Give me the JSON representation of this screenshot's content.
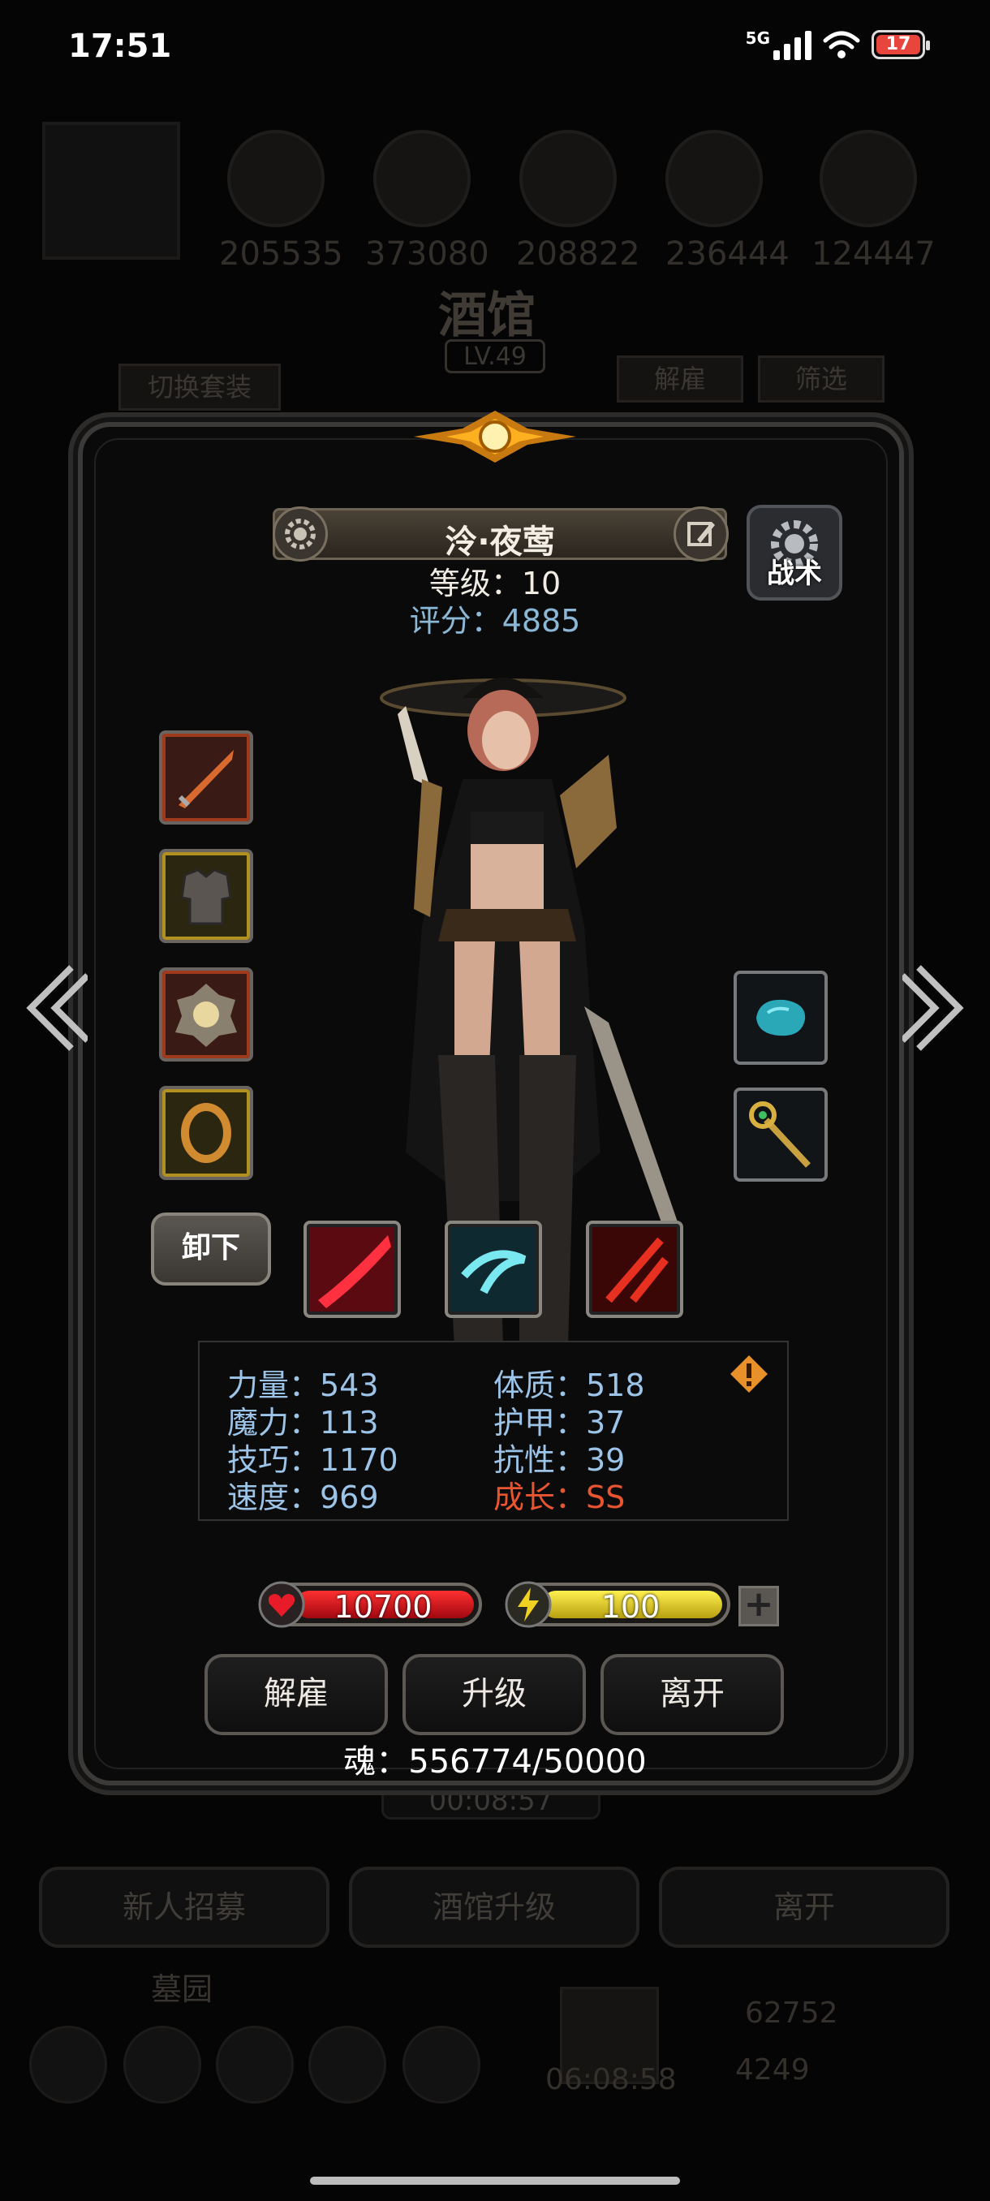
{
  "status_bar": {
    "time": "17:51",
    "network": "5G",
    "battery": "17"
  },
  "background": {
    "resources": [
      "205535",
      "373080",
      "208822",
      "236444",
      "124447"
    ],
    "title": "酒馆",
    "level": "LV.49",
    "tabs": {
      "switch_outfit": "切换套装",
      "dismiss": "解雇",
      "filter": "筛选"
    },
    "timer": "00:08:57",
    "buttons": {
      "recruit": "新人招募",
      "upgrade": "酒馆升级",
      "leave": "离开"
    },
    "guild_label": "墓园",
    "gift_timer": "06:08:58",
    "currency_gold": "62752",
    "currency_gem": "4249"
  },
  "hero": {
    "name": "泠·夜莺",
    "level_label": "等级：10",
    "score_label": "评分：4885",
    "tactics_label": "战术",
    "unequip_label": "卸下"
  },
  "stats": {
    "strength": "力量：543",
    "constitution": "体质：518",
    "magic": "魔力：113",
    "armor": "护甲：37",
    "skill": "技巧：1170",
    "resistance": "抗性：39",
    "speed": "速度：969",
    "growth": "成长：SS"
  },
  "bars": {
    "hp": "10700",
    "energy": "100"
  },
  "actions": {
    "dismiss": "解雇",
    "upgrade": "升级",
    "leave": "离开"
  },
  "soul": "魂：556774/50000",
  "colors": {
    "accent_blue": "#8ab8d6",
    "growth_red": "#e85530",
    "hp_red": "#d01820",
    "energy_yellow": "#e8d020"
  }
}
